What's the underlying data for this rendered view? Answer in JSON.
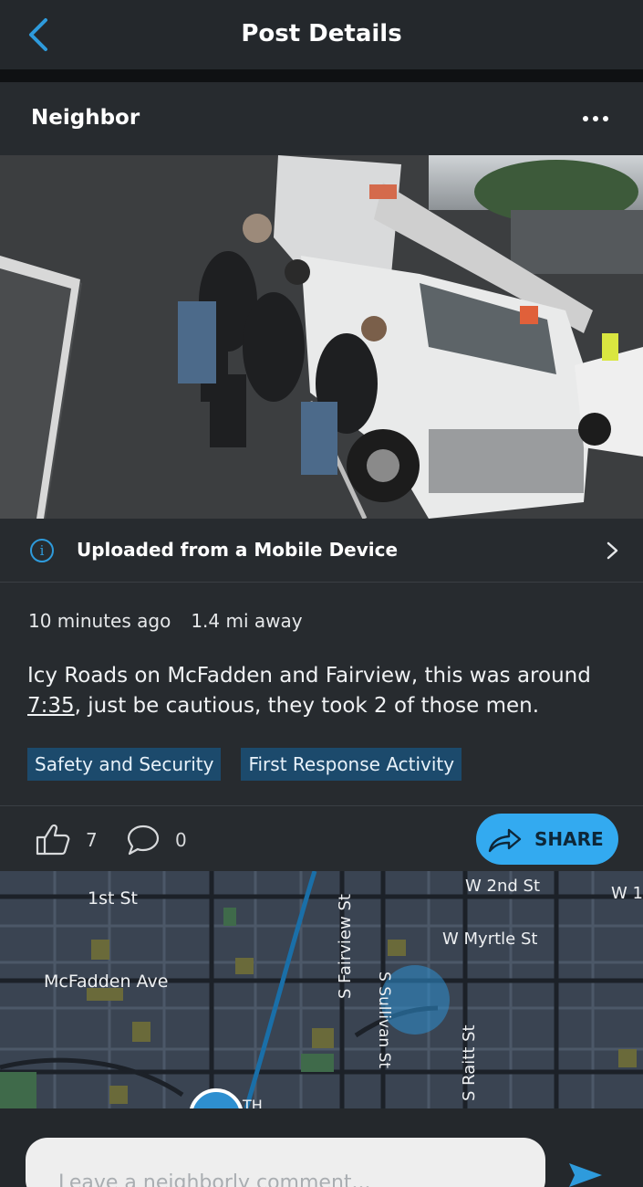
{
  "header": {
    "title": "Post Details",
    "back_icon": "chevron-left-icon"
  },
  "post": {
    "author": "Neighbor",
    "more_icon": "more-horizontal-icon",
    "upload_source": "Uploaded from a Mobile Device",
    "time_ago": "10 minutes ago",
    "distance": "1.4 mi away",
    "text_before": "Icy Roads on McFadden and Fairview, this was around ",
    "text_link": "7:35",
    "text_after": ", just be cautious, they took 2 of those men.",
    "tags": [
      "Safety and Security",
      "First Response Activity"
    ],
    "likes": "7",
    "comments": "0",
    "share_label": "SHARE"
  },
  "map": {
    "streets": {
      "first": "1st St",
      "w2nd": "W 2nd St",
      "w1": "W 1",
      "wmyrtle": "W Myrtle St",
      "mcfadden": "McFadden Ave",
      "fairview": "S Fairview St",
      "sullivan": "S Sullivan St",
      "raitt": "S Raitt St",
      "bottom": "TH"
    }
  },
  "comment": {
    "placeholder": "Leave a neighborly comment..."
  },
  "colors": {
    "accent": "#33aaf0",
    "tag_bg": "#1c4a6c",
    "background": "#202427"
  }
}
